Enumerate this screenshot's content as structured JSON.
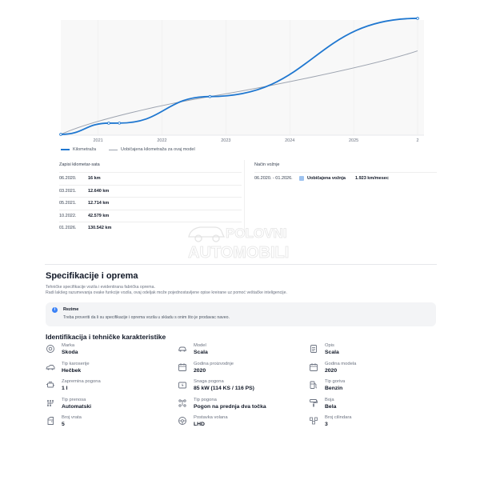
{
  "chart_data": {
    "type": "line",
    "x_ticks": [
      "2021",
      "2022",
      "2023",
      "2024",
      "2025",
      "2"
    ],
    "series": [
      {
        "name": "Kilometraža",
        "color": "#1f77d0",
        "style": "dashed-markers",
        "points": [
          [
            "2020-06",
            16
          ],
          [
            "2021-03",
            12640
          ],
          [
            "2021-05",
            12714
          ],
          [
            "2022-10",
            42579
          ],
          [
            "2026-01",
            130542
          ]
        ]
      },
      {
        "name": "Uobičajena kilometraža za ovaj model",
        "color": "#9ca3af",
        "style": "solid",
        "points": [
          [
            "2020-06",
            0
          ],
          [
            "2022-10",
            42579
          ],
          [
            "2026-01",
            94000
          ]
        ]
      }
    ],
    "grid": true
  },
  "legend": {
    "mileage": "Kilometraža",
    "typical": "Uobičajena kilometraža za ovaj model"
  },
  "readings": {
    "title": "Zapisi kilometar-sata",
    "rows": [
      {
        "date": "06.2020.",
        "km": "16 km"
      },
      {
        "date": "03.2021.",
        "km": "12.640 km"
      },
      {
        "date": "05.2021.",
        "km": "12.714 km"
      },
      {
        "date": "10.2022.",
        "km": "42.579 km"
      },
      {
        "date": "01.2026.",
        "km": "130.542 km"
      }
    ]
  },
  "driving": {
    "title": "Način vožnje",
    "period": "06.2020. - 01.2026.",
    "label": "Uobičajena vožnja",
    "value": "1.923 km/mesec"
  },
  "watermark": {
    "line1": "POLOVNI",
    "line2": "AUTOMOBILI"
  },
  "specs": {
    "title": "Specifikacije i oprema",
    "sub1": "Tehničke specifikacije vozila i evidentirana fabrička oprema.",
    "sub2": "Radi lakšeg razumevanja ovake funkcije vozila, ovaj odeljak može pojednostavljene opise kreirane uz pomoć veštačke inteligencije.",
    "notice_title": "Rezime",
    "notice_text": "Treba proveriti da li su specifikacije i oprema vozila u skladu s onim što je prodavac naveo.",
    "section_title": "Identifikacija i tehničke karakteristike",
    "items": [
      {
        "label": "Marka",
        "value": "Skoda",
        "icon": "badge-icon"
      },
      {
        "label": "Model",
        "value": "Scala",
        "icon": "car-icon"
      },
      {
        "label": "Opis",
        "value": "Scala",
        "icon": "document-icon"
      },
      {
        "label": "Tip karoserije",
        "value": "Hečbek",
        "icon": "car-body-icon"
      },
      {
        "label": "Godina proizvodnje",
        "value": "2020",
        "icon": "calendar-icon"
      },
      {
        "label": "Godina modela",
        "value": "2020",
        "icon": "calendar-icon"
      },
      {
        "label": "Zapremina pogona",
        "value": "1 l",
        "icon": "engine-icon"
      },
      {
        "label": "Snaga pogona",
        "value": "85 kW (114 KS / 116 PS)",
        "icon": "battery-bolt-icon"
      },
      {
        "label": "Tip goriva",
        "value": "Benzin",
        "icon": "fuel-pump-icon"
      },
      {
        "label": "Tip prenosa",
        "value": "Automatski",
        "icon": "gearbox-icon"
      },
      {
        "label": "Tip pogona",
        "value": "Pogon na prednja dva točka",
        "icon": "drivetrain-icon"
      },
      {
        "label": "Boja",
        "value": "Bela",
        "icon": "paint-roller-icon"
      },
      {
        "label": "Broj vrata",
        "value": "5",
        "icon": "door-icon"
      },
      {
        "label": "Postavka volana",
        "value": "LHD",
        "icon": "steering-wheel-icon"
      },
      {
        "label": "Broj cilindara",
        "value": "3",
        "icon": "cylinders-icon"
      }
    ]
  }
}
